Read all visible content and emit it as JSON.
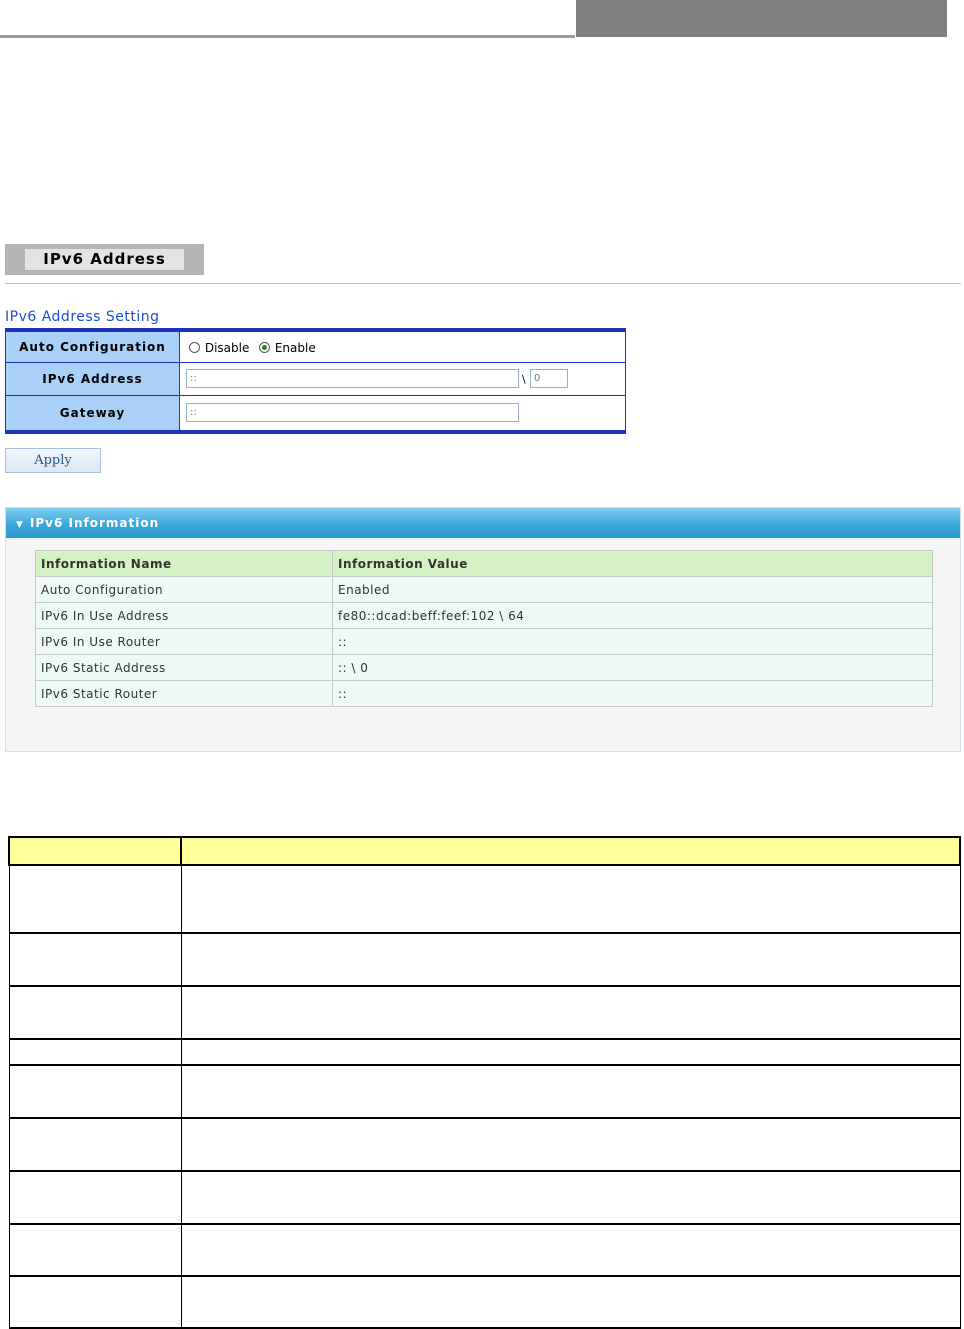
{
  "section_tab": {
    "title": "IPv6 Address"
  },
  "setting": {
    "title": "IPv6 Address Setting",
    "auto_config": {
      "label": "Auto Configuration",
      "options": [
        "Disable",
        "Enable"
      ],
      "selected": "Enable"
    },
    "ipv6_address": {
      "label": "IPv6 Address",
      "value_placeholder": "::",
      "separator": "\\",
      "prefix_placeholder": "0"
    },
    "gateway": {
      "label": "Gateway",
      "placeholder": "::"
    },
    "apply_label": "Apply"
  },
  "info_panel": {
    "title": "IPv6 Information",
    "columns": [
      "Information Name",
      "Information Value"
    ],
    "rows": [
      {
        "name": "Auto Configuration",
        "value": "Enabled"
      },
      {
        "name": "IPv6 In Use Address",
        "value": "fe80::dcad:beff:feef:102 \\ 64"
      },
      {
        "name": "IPv6 In Use Router",
        "value": "::"
      },
      {
        "name": "IPv6 Static Address",
        "value": ":: \\ 0"
      },
      {
        "name": "IPv6 Static Router",
        "value": "::"
      }
    ]
  },
  "colors": {
    "header_gray": "#808080",
    "form_border": "#1f33b9",
    "form_label_bg": "#a9d0f7",
    "setting_title": "#1a4fd6",
    "panel_header": "#3aa8dc",
    "info_header_bg": "#d4f2c3",
    "info_row_bg": "#ecf9f6",
    "desc_header_bg": "#ffff99"
  }
}
